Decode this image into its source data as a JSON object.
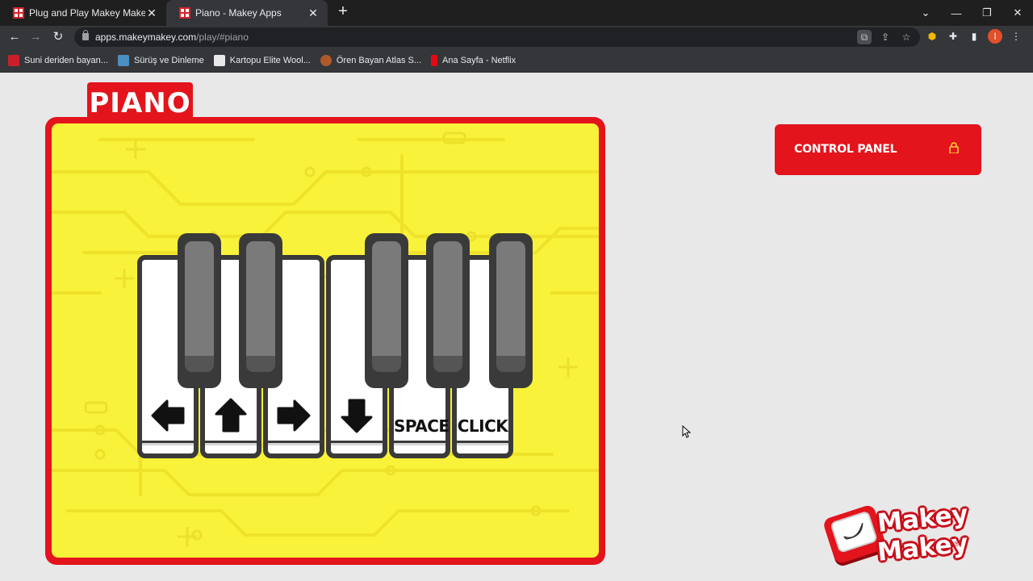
{
  "browser": {
    "tabs": [
      {
        "title": "Plug and Play Makey Makey App",
        "active": false
      },
      {
        "title": "Piano - Makey Apps",
        "active": true
      }
    ],
    "new_tab_symbol": "+",
    "url": {
      "host": "apps.makeymakey.com",
      "path": "/play/#piano"
    },
    "bookmarks": [
      {
        "label": "Suni deriden bayan...",
        "icon_color": "#c8202a"
      },
      {
        "label": "Sürüş ve Dinleme",
        "icon_color": "#4a8ec2"
      },
      {
        "label": "Kartopu Elite Wool...",
        "icon_color": "#e8e8e8"
      },
      {
        "label": "Ören Bayan Atlas S...",
        "icon_color": "#b05a2a"
      },
      {
        "label": "Ana Sayfa - Netflix",
        "icon_color": "#e50914"
      }
    ],
    "profile_initial": "I"
  },
  "app": {
    "title": "PIANO",
    "keys": [
      {
        "label": "",
        "icon": "arrow-left-icon"
      },
      {
        "label": "",
        "icon": "arrow-up-icon"
      },
      {
        "label": "",
        "icon": "arrow-right-icon"
      },
      {
        "label": "",
        "icon": "arrow-down-icon"
      },
      {
        "label": "SPACE",
        "icon": ""
      },
      {
        "label": "CLICK",
        "icon": ""
      }
    ],
    "control_panel": {
      "label": "CONTROL PANEL",
      "icon": "lock-icon"
    },
    "logo": {
      "line1": "Makey",
      "line2": "Makey",
      "reg": "®"
    }
  },
  "colors": {
    "brand_red": "#e3141c",
    "board_yellow": "#f9f23a",
    "page_bg": "#e8e8e8"
  }
}
